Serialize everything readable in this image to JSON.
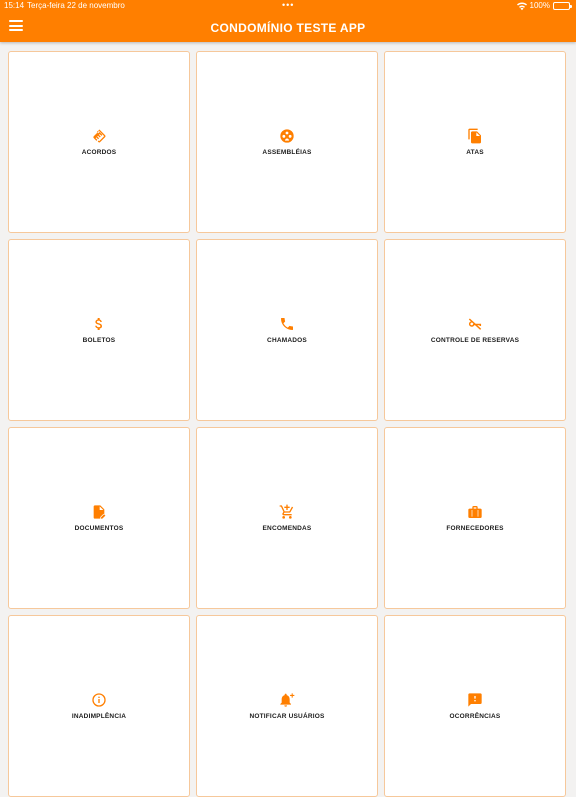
{
  "status_bar": {
    "time": "15:14",
    "date": "Terça-feira 22 de novembro",
    "dots": "•••",
    "battery": "100%"
  },
  "app_bar": {
    "title": "CONDOMÍNIO TESTE APP",
    "color": "#ff7f00"
  },
  "tiles": [
    {
      "label": "ACORDOS",
      "icon": "handshake-icon"
    },
    {
      "label": "ASSEMBLÉIAS",
      "icon": "group-icon"
    },
    {
      "label": "ATAS",
      "icon": "copy-document-icon"
    },
    {
      "label": "BOLETOS",
      "icon": "dollar-icon"
    },
    {
      "label": "CHAMADOS",
      "icon": "phone-icon"
    },
    {
      "label": "CONTROLE DE RESERVAS",
      "icon": "key-off-icon"
    },
    {
      "label": "DOCUMENTOS",
      "icon": "document-icon"
    },
    {
      "label": "ENCOMENDAS",
      "icon": "add-cart-icon"
    },
    {
      "label": "FORNECEDORES",
      "icon": "briefcase-icon"
    },
    {
      "label": "INADIMPLÊNCIA",
      "icon": "info-icon"
    },
    {
      "label": "NOTIFICAR USUÁRIOS",
      "icon": "bell-add-icon"
    },
    {
      "label": "OCORRÊNCIAS",
      "icon": "feedback-icon"
    }
  ]
}
